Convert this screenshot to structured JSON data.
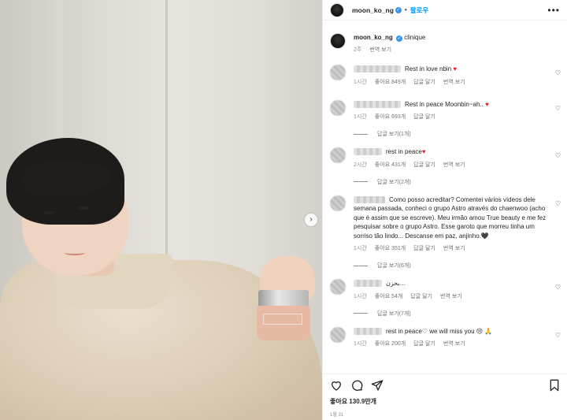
{
  "post": {
    "username": "moon_ko_ng",
    "follow_label": "팔로우",
    "more_label": "•••",
    "carousel_next": "›"
  },
  "caption": {
    "username": "moon_ko_ng",
    "text": "clinique",
    "time": "2주",
    "translate": "번역 보기"
  },
  "comments": [
    {
      "text": "Rest in love nbin",
      "emoji": "♥",
      "time": "1시간",
      "likes": "좋아요 849개",
      "reply": "답글 달기",
      "translate": "번역 보기",
      "replies": ""
    },
    {
      "text": "Rest in peace Moonbin~ah..",
      "emoji": "♥",
      "time": "1시간",
      "likes": "좋아요 693개",
      "reply": "답글 달기",
      "translate": "",
      "replies": "답글 보기(1개)"
    },
    {
      "text": "rest in peace",
      "emoji": "♥",
      "time": "2시간",
      "likes": "좋아요 431개",
      "reply": "답글 달기",
      "translate": "번역 보기",
      "replies": "답글 보기(2개)"
    },
    {
      "text": "Como posso acreditar? Comentei vários vídeos dele semana passada, conheci o grupo Astro através do chaenwoo (acho que é assim que se escreve). Meu irmão amou True beauty e me fez pesquisar sobre o grupo Astro. Esse garoto que morreu tinha um sorriso tão lindo... Descanse em paz, anjinho.",
      "emoji": "🖤",
      "time": "1시간",
      "likes": "좋아요 351개",
      "reply": "답글 달기",
      "translate": "번역 보기",
      "replies": "답글 보기(6개)"
    },
    {
      "text": "بحزن...",
      "emoji": "",
      "time": "1시간",
      "likes": "좋아요 54개",
      "reply": "답글 달기",
      "translate": "번역 보기",
      "replies": "답글 보기(7개)"
    },
    {
      "text": "rest in peace♡  we will miss you",
      "emoji": "😢 🙏",
      "time": "1시간",
      "likes": "좋아요 200개",
      "reply": "답글 달기",
      "translate": "번역 보기",
      "replies": ""
    }
  ],
  "footer": {
    "likes": "좋아요 130.9만개",
    "date": "1월 31"
  },
  "icons": [
    "heart-icon",
    "comment-icon",
    "share-icon",
    "bookmark-icon",
    "verified-icon"
  ],
  "colors": {
    "accent": "#0095f6",
    "verified": "#3797f0",
    "heart": "#ed1c24"
  }
}
